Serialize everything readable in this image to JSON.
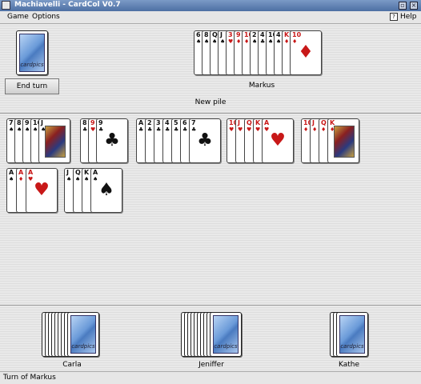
{
  "window": {
    "title": "Machiavelli - CardCol V0.7"
  },
  "menu": {
    "game": "Game",
    "options": "Options",
    "help": "Help"
  },
  "controls": {
    "end_turn": "End turn",
    "new_pile": "New pile"
  },
  "deck": {
    "logo": "cardpics"
  },
  "players": {
    "markus": "Markus",
    "carla": "Carla",
    "jeniffer": "Jeniffer",
    "kathe": "Kathe"
  },
  "status": {
    "text": "Turn of Markus"
  },
  "hand": [
    {
      "rank": "6",
      "suit": "♠",
      "color": "blk"
    },
    {
      "rank": "8",
      "suit": "♠",
      "color": "blk"
    },
    {
      "rank": "Q",
      "suit": "♠",
      "color": "blk"
    },
    {
      "rank": "J",
      "suit": "♠",
      "color": "blk"
    },
    {
      "rank": "3",
      "suit": "♥",
      "color": "red"
    },
    {
      "rank": "9",
      "suit": "♦",
      "color": "red"
    },
    {
      "rank": "10",
      "suit": "♦",
      "color": "red"
    },
    {
      "rank": "2",
      "suit": "♠",
      "color": "blk"
    },
    {
      "rank": "4",
      "suit": "♣",
      "color": "blk"
    },
    {
      "rank": "10",
      "suit": "♠",
      "color": "blk"
    },
    {
      "rank": "4",
      "suit": "♠",
      "color": "blk"
    },
    {
      "rank": "K",
      "suit": "♦",
      "color": "red"
    },
    {
      "rank": "10",
      "suit": "♦",
      "color": "red"
    }
  ],
  "piles": [
    {
      "cards": [
        {
          "rank": "7",
          "suit": "♠",
          "color": "blk"
        },
        {
          "rank": "8",
          "suit": "♠",
          "color": "blk"
        },
        {
          "rank": "9",
          "suit": "♠",
          "color": "blk"
        },
        {
          "rank": "10",
          "suit": "♠",
          "color": "blk"
        },
        {
          "rank": "J",
          "suit": "♠",
          "color": "blk",
          "face": true
        }
      ]
    },
    {
      "cards": [
        {
          "rank": "8",
          "suit": "♣",
          "color": "blk"
        },
        {
          "rank": "9",
          "suit": "♥",
          "color": "red"
        },
        {
          "rank": "9",
          "suit": "♣",
          "color": "blk"
        }
      ]
    },
    {
      "cards": [
        {
          "rank": "A",
          "suit": "♣",
          "color": "blk"
        },
        {
          "rank": "2",
          "suit": "♣",
          "color": "blk"
        },
        {
          "rank": "3",
          "suit": "♣",
          "color": "blk"
        },
        {
          "rank": "4",
          "suit": "♣",
          "color": "blk"
        },
        {
          "rank": "5",
          "suit": "♣",
          "color": "blk"
        },
        {
          "rank": "6",
          "suit": "♣",
          "color": "blk"
        },
        {
          "rank": "7",
          "suit": "♣",
          "color": "blk"
        }
      ]
    },
    {
      "cards": [
        {
          "rank": "10",
          "suit": "♥",
          "color": "red"
        },
        {
          "rank": "J",
          "suit": "♥",
          "color": "red"
        },
        {
          "rank": "Q",
          "suit": "♥",
          "color": "red"
        },
        {
          "rank": "K",
          "suit": "♥",
          "color": "red"
        },
        {
          "rank": "A",
          "suit": "♥",
          "color": "red"
        }
      ]
    },
    {
      "cards": [
        {
          "rank": "10",
          "suit": "♦",
          "color": "red"
        },
        {
          "rank": "J",
          "suit": "♦",
          "color": "red"
        },
        {
          "rank": "Q",
          "suit": "♦",
          "color": "red"
        },
        {
          "rank": "K",
          "suit": "♦",
          "color": "red",
          "face": true
        }
      ]
    },
    {
      "cards": [
        {
          "rank": "A",
          "suit": "♠",
          "color": "blk"
        },
        {
          "rank": "A",
          "suit": "♦",
          "color": "red"
        },
        {
          "rank": "A",
          "suit": "♥",
          "color": "red"
        }
      ]
    },
    {
      "cards": [
        {
          "rank": "J",
          "suit": "♠",
          "color": "blk"
        },
        {
          "rank": "Q",
          "suit": "♠",
          "color": "blk"
        },
        {
          "rank": "K",
          "suit": "♠",
          "color": "blk"
        },
        {
          "rank": "A",
          "suit": "♠",
          "color": "blk"
        }
      ]
    }
  ],
  "colors": {
    "red": "#c81818",
    "black": "#111111",
    "titlebar": "#4d6fa3"
  }
}
